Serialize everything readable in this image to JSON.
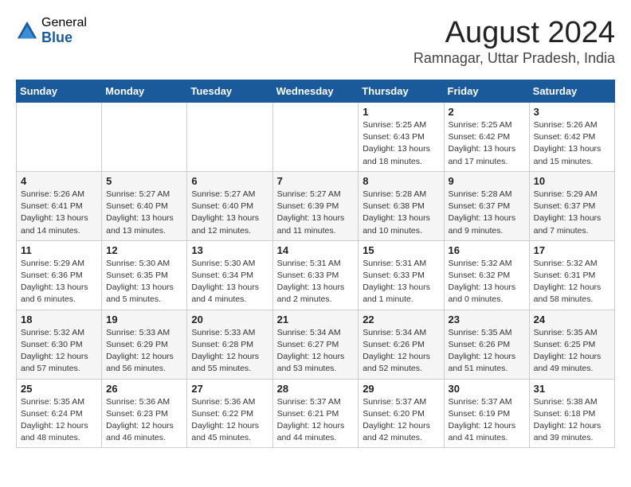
{
  "logo": {
    "general": "General",
    "blue": "Blue"
  },
  "title": "August 2024",
  "subtitle": "Ramnagar, Uttar Pradesh, India",
  "days_of_week": [
    "Sunday",
    "Monday",
    "Tuesday",
    "Wednesday",
    "Thursday",
    "Friday",
    "Saturday"
  ],
  "weeks": [
    [
      {
        "day": "",
        "info": ""
      },
      {
        "day": "",
        "info": ""
      },
      {
        "day": "",
        "info": ""
      },
      {
        "day": "",
        "info": ""
      },
      {
        "day": "1",
        "info": "Sunrise: 5:25 AM\nSunset: 6:43 PM\nDaylight: 13 hours\nand 18 minutes."
      },
      {
        "day": "2",
        "info": "Sunrise: 5:25 AM\nSunset: 6:42 PM\nDaylight: 13 hours\nand 17 minutes."
      },
      {
        "day": "3",
        "info": "Sunrise: 5:26 AM\nSunset: 6:42 PM\nDaylight: 13 hours\nand 15 minutes."
      }
    ],
    [
      {
        "day": "4",
        "info": "Sunrise: 5:26 AM\nSunset: 6:41 PM\nDaylight: 13 hours\nand 14 minutes."
      },
      {
        "day": "5",
        "info": "Sunrise: 5:27 AM\nSunset: 6:40 PM\nDaylight: 13 hours\nand 13 minutes."
      },
      {
        "day": "6",
        "info": "Sunrise: 5:27 AM\nSunset: 6:40 PM\nDaylight: 13 hours\nand 12 minutes."
      },
      {
        "day": "7",
        "info": "Sunrise: 5:27 AM\nSunset: 6:39 PM\nDaylight: 13 hours\nand 11 minutes."
      },
      {
        "day": "8",
        "info": "Sunrise: 5:28 AM\nSunset: 6:38 PM\nDaylight: 13 hours\nand 10 minutes."
      },
      {
        "day": "9",
        "info": "Sunrise: 5:28 AM\nSunset: 6:37 PM\nDaylight: 13 hours\nand 9 minutes."
      },
      {
        "day": "10",
        "info": "Sunrise: 5:29 AM\nSunset: 6:37 PM\nDaylight: 13 hours\nand 7 minutes."
      }
    ],
    [
      {
        "day": "11",
        "info": "Sunrise: 5:29 AM\nSunset: 6:36 PM\nDaylight: 13 hours\nand 6 minutes."
      },
      {
        "day": "12",
        "info": "Sunrise: 5:30 AM\nSunset: 6:35 PM\nDaylight: 13 hours\nand 5 minutes."
      },
      {
        "day": "13",
        "info": "Sunrise: 5:30 AM\nSunset: 6:34 PM\nDaylight: 13 hours\nand 4 minutes."
      },
      {
        "day": "14",
        "info": "Sunrise: 5:31 AM\nSunset: 6:33 PM\nDaylight: 13 hours\nand 2 minutes."
      },
      {
        "day": "15",
        "info": "Sunrise: 5:31 AM\nSunset: 6:33 PM\nDaylight: 13 hours\nand 1 minute."
      },
      {
        "day": "16",
        "info": "Sunrise: 5:32 AM\nSunset: 6:32 PM\nDaylight: 13 hours\nand 0 minutes."
      },
      {
        "day": "17",
        "info": "Sunrise: 5:32 AM\nSunset: 6:31 PM\nDaylight: 12 hours\nand 58 minutes."
      }
    ],
    [
      {
        "day": "18",
        "info": "Sunrise: 5:32 AM\nSunset: 6:30 PM\nDaylight: 12 hours\nand 57 minutes."
      },
      {
        "day": "19",
        "info": "Sunrise: 5:33 AM\nSunset: 6:29 PM\nDaylight: 12 hours\nand 56 minutes."
      },
      {
        "day": "20",
        "info": "Sunrise: 5:33 AM\nSunset: 6:28 PM\nDaylight: 12 hours\nand 55 minutes."
      },
      {
        "day": "21",
        "info": "Sunrise: 5:34 AM\nSunset: 6:27 PM\nDaylight: 12 hours\nand 53 minutes."
      },
      {
        "day": "22",
        "info": "Sunrise: 5:34 AM\nSunset: 6:26 PM\nDaylight: 12 hours\nand 52 minutes."
      },
      {
        "day": "23",
        "info": "Sunrise: 5:35 AM\nSunset: 6:26 PM\nDaylight: 12 hours\nand 51 minutes."
      },
      {
        "day": "24",
        "info": "Sunrise: 5:35 AM\nSunset: 6:25 PM\nDaylight: 12 hours\nand 49 minutes."
      }
    ],
    [
      {
        "day": "25",
        "info": "Sunrise: 5:35 AM\nSunset: 6:24 PM\nDaylight: 12 hours\nand 48 minutes."
      },
      {
        "day": "26",
        "info": "Sunrise: 5:36 AM\nSunset: 6:23 PM\nDaylight: 12 hours\nand 46 minutes."
      },
      {
        "day": "27",
        "info": "Sunrise: 5:36 AM\nSunset: 6:22 PM\nDaylight: 12 hours\nand 45 minutes."
      },
      {
        "day": "28",
        "info": "Sunrise: 5:37 AM\nSunset: 6:21 PM\nDaylight: 12 hours\nand 44 minutes."
      },
      {
        "day": "29",
        "info": "Sunrise: 5:37 AM\nSunset: 6:20 PM\nDaylight: 12 hours\nand 42 minutes."
      },
      {
        "day": "30",
        "info": "Sunrise: 5:37 AM\nSunset: 6:19 PM\nDaylight: 12 hours\nand 41 minutes."
      },
      {
        "day": "31",
        "info": "Sunrise: 5:38 AM\nSunset: 6:18 PM\nDaylight: 12 hours\nand 39 minutes."
      }
    ]
  ]
}
